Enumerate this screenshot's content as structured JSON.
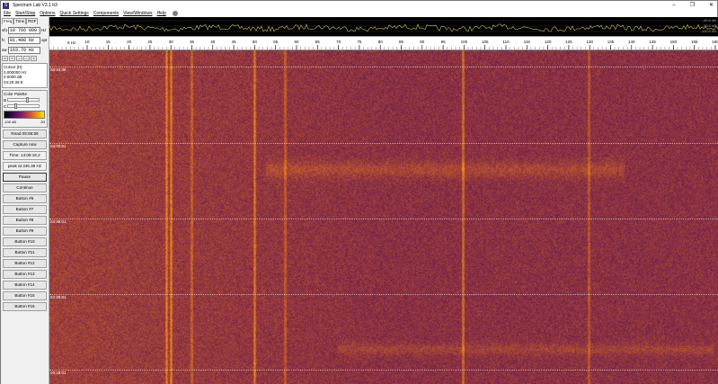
{
  "window": {
    "title": "Spectrum Lab V3.1 b3",
    "minimize": "–",
    "maximize": "❐",
    "close": "✕"
  },
  "menu": [
    "File",
    "Start/Stop",
    "Options",
    "Quick Settings",
    "Components",
    "View/Windows",
    "Help"
  ],
  "left_panel": {
    "tabs": [
      "Freq",
      "Time",
      "RDF"
    ],
    "fields": [
      {
        "label": "vfo",
        "value": "10 766 000",
        "unit": "Hz"
      },
      {
        "label": "fc",
        "value": "81.408 Hz",
        "unit": "opt"
      },
      {
        "label": "sw",
        "value": "163.70 Hz",
        "unit": ""
      }
    ],
    "nav_buttons": [
      "<",
      "<",
      "–",
      "–",
      ">"
    ],
    "cursor": {
      "title": "Cursor [H]",
      "lines": [
        "0.000000 Hz",
        "0.0000 dB",
        "04:20:39.9"
      ]
    },
    "palette": {
      "title": "Color Palette",
      "brightness_label": "B",
      "contrast_label": "C",
      "brightness": 0.6,
      "contrast": 0.2,
      "scale_min": "-100 dB",
      "scale_max": "-53"
    },
    "read_button": "Read 05:55:59",
    "capture_button": "Capture now",
    "time_readout": "Time: 14:09:16.2",
    "peak_readout": "peak at 346.39 Hz",
    "pause_button": "Pause",
    "continue_button": "Continue",
    "buttons": [
      "Button #6",
      "Button #7",
      "Button #8",
      "Button #9",
      "Button #10",
      "Button #11",
      "Button #12",
      "Button #13",
      "Button #14",
      "Button #15",
      "Button #16"
    ]
  },
  "spectrum": {
    "labels": [
      "-80.0 dB",
      "-90.0 dB",
      "-100.0 dB"
    ]
  },
  "freq_axis": {
    "unit": "5 Hz",
    "ticks": [
      "10",
      "15",
      "20",
      "25",
      "30",
      "35",
      "40",
      "45",
      "50",
      "55",
      "60",
      "65",
      "70",
      "75",
      "80",
      "85",
      "90",
      "95",
      "100",
      "105",
      "110",
      "115",
      "120",
      "125",
      "130",
      "135",
      "140",
      "145",
      "150",
      "155",
      "160"
    ]
  },
  "waterfall": {
    "timestamps": [
      "04:43:08",
      "04:40:01",
      "04:35:01",
      "04:30:01",
      "04:25:01"
    ]
  },
  "colors": {
    "waterfall_base": "#6a1f5a",
    "waterfall_hot": "#d67a1e",
    "trace": "#c8c850"
  }
}
